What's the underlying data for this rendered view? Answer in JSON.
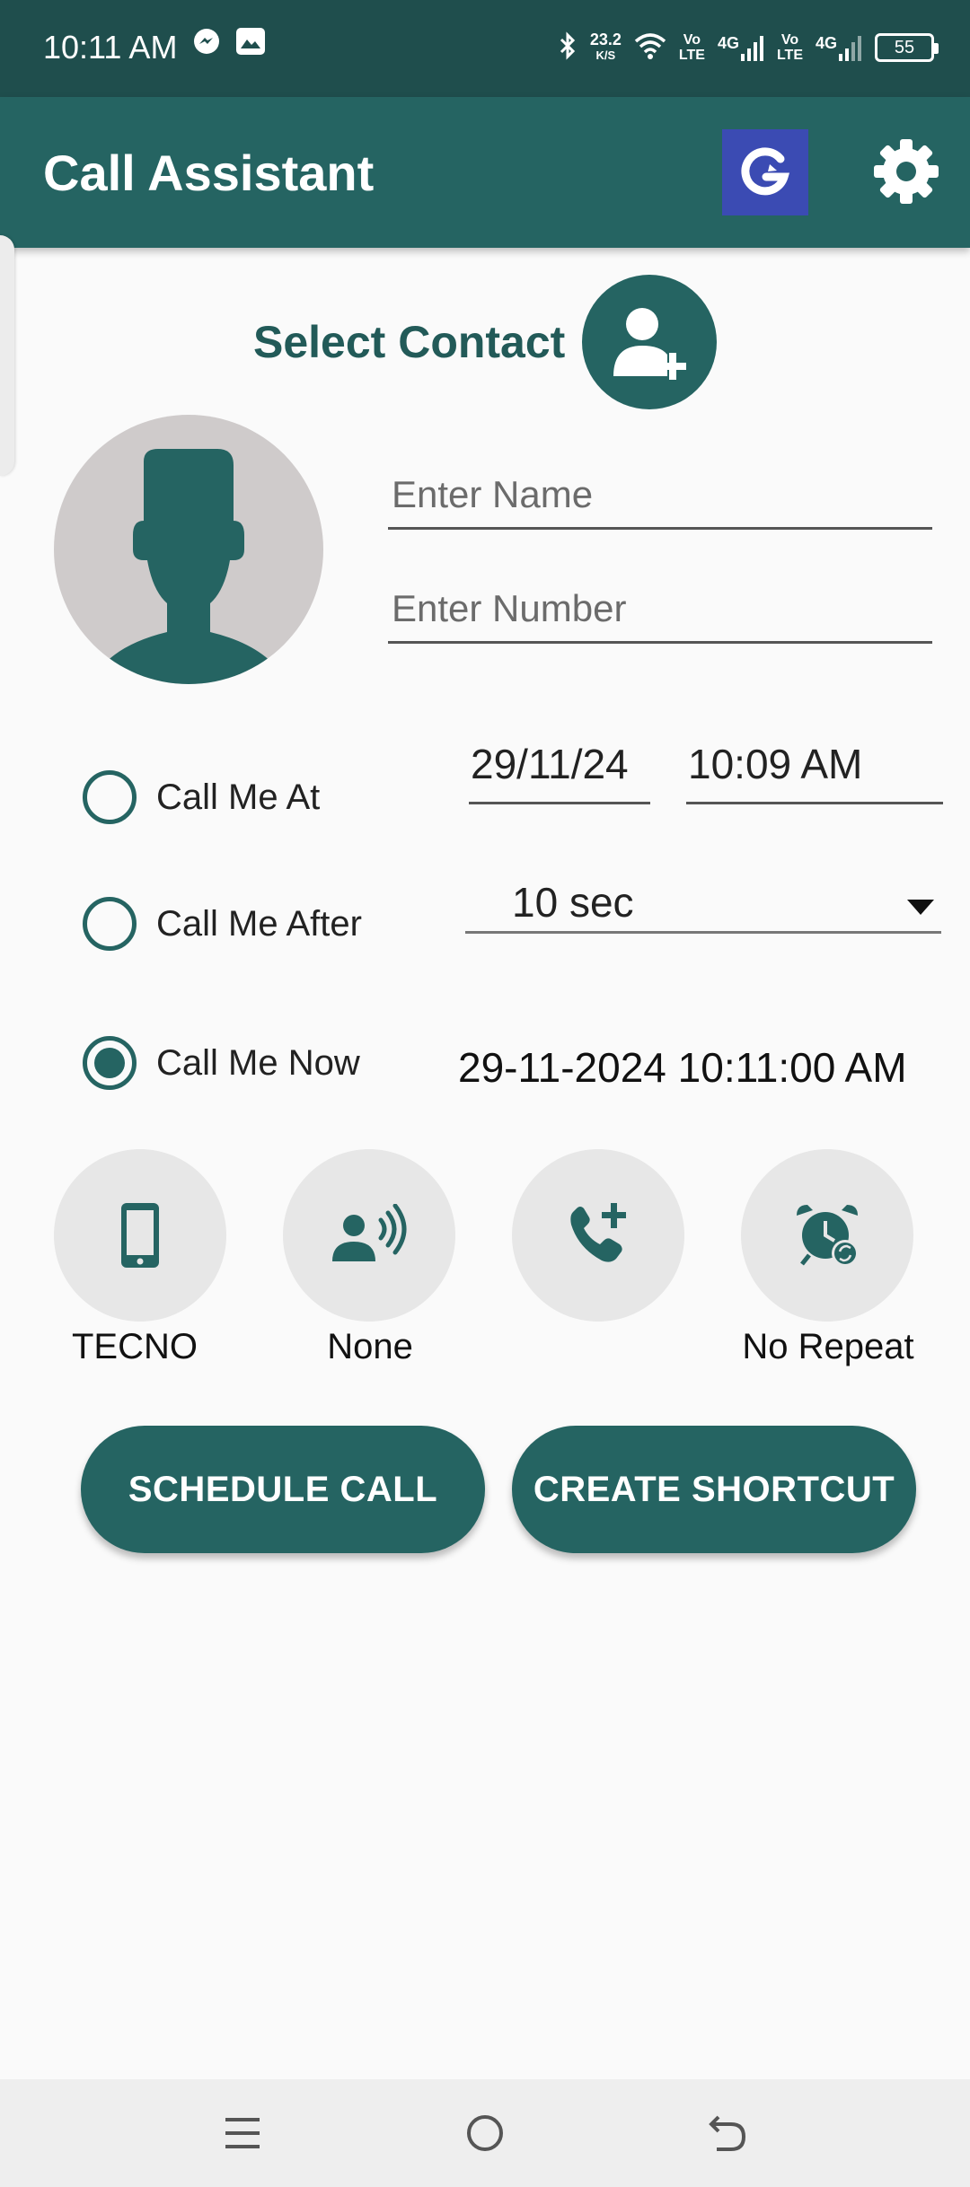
{
  "status_bar": {
    "time": "10:11 AM",
    "net_speed": "23.2",
    "net_unit": "K/S",
    "volte_top": "Vo",
    "volte_bottom": "LTE",
    "network_1": "4G",
    "network_2": "4G",
    "battery": "55"
  },
  "app_bar": {
    "title": "Call Assistant"
  },
  "contact": {
    "select_label": "Select Contact",
    "name_placeholder": "Enter Name",
    "number_placeholder": "Enter Number"
  },
  "schedule": {
    "call_me_at_label": "Call Me At",
    "date": "29/11/24",
    "time": "10:09 AM",
    "call_me_after_label": "Call Me After",
    "delay_value": "10 sec",
    "call_me_now_label": "Call Me Now",
    "now_value": "29-11-2024 10:11:00 AM",
    "selected_option": "call_me_now"
  },
  "options": {
    "sim_label": "TECNO",
    "voice_label": "None",
    "add_call_label": "",
    "repeat_label": "No Repeat"
  },
  "actions": {
    "schedule_label": "SCHEDULE CALL",
    "shortcut_label": "CREATE SHORTCUT"
  },
  "colors": {
    "primary": "#256462",
    "status_bar": "#1f4e4d",
    "accent_badge": "#3b4bb3",
    "avatar_bg": "#cfcbcb"
  }
}
